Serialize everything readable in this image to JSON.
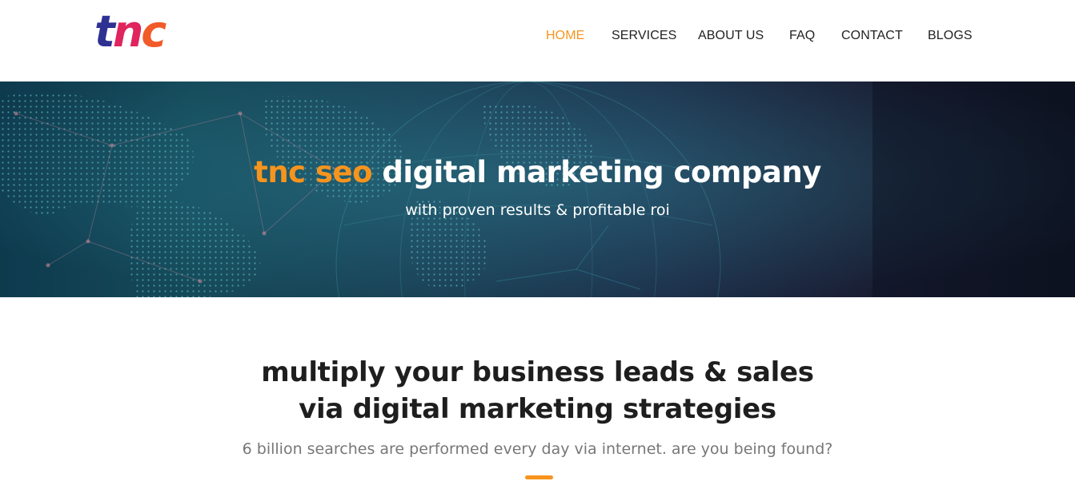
{
  "header": {
    "logo_text": "tnc",
    "logo_colors": {
      "t": "#2e3192",
      "n": "#e0245e",
      "c": "#f15a29"
    },
    "nav": [
      {
        "label": "HOME",
        "active": true
      },
      {
        "label": "SERVICES",
        "active": false
      },
      {
        "label": "ABOUT US",
        "active": false
      },
      {
        "label": "FAQ",
        "active": false
      },
      {
        "label": "CONTACT",
        "active": false
      },
      {
        "label": "BLOGS",
        "active": false
      }
    ]
  },
  "hero": {
    "title_accent": "tnc seo",
    "title_rest": " digital marketing company",
    "subtitle": "with proven results & profitable roi"
  },
  "intro": {
    "headline_line1": "multiply your business leads & sales",
    "headline_line2": "via digital marketing strategies",
    "tagline": "6 billion searches are performed every day via internet. are you being found?"
  },
  "colors": {
    "accent": "#f7941d",
    "nav_text": "#222222",
    "heading": "#1e1e1e",
    "muted": "#777777"
  }
}
